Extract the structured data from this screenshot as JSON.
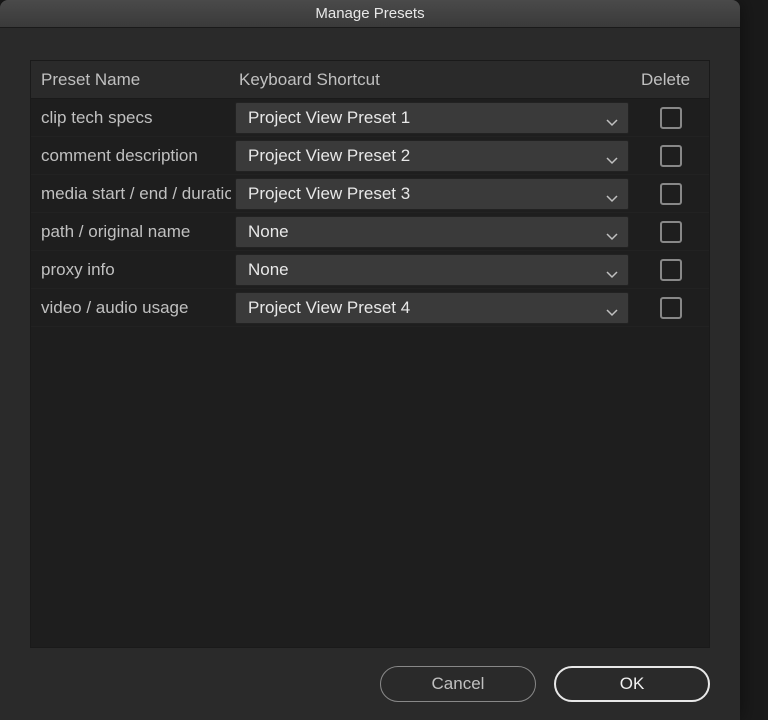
{
  "dialog": {
    "title": "Manage Presets"
  },
  "columns": {
    "name": "Preset Name",
    "shortcut": "Keyboard Shortcut",
    "delete": "Delete"
  },
  "rows": [
    {
      "name": "clip tech specs",
      "shortcut": "Project View Preset 1"
    },
    {
      "name": "comment description",
      "shortcut": "Project View Preset 2"
    },
    {
      "name": "media start / end / duration",
      "shortcut": "Project View Preset 3"
    },
    {
      "name": "path / original name",
      "shortcut": "None"
    },
    {
      "name": "proxy info",
      "shortcut": "None"
    },
    {
      "name": "video / audio usage",
      "shortcut": "Project View Preset 4"
    }
  ],
  "buttons": {
    "cancel": "Cancel",
    "ok": "OK"
  }
}
